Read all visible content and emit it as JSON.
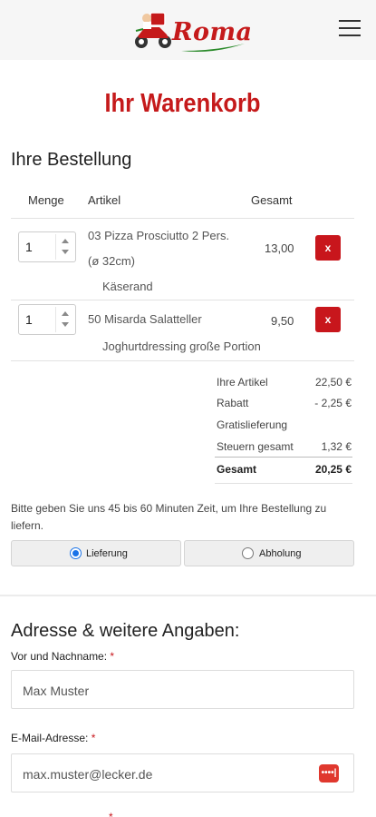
{
  "header": {
    "logo_text": "Roma",
    "menu_icon": "hamburger-menu-icon"
  },
  "page_title": "Ihr Warenkorb",
  "order": {
    "title": "Ihre Bestellung",
    "columns": [
      "Menge",
      "Artikel",
      "Gesamt"
    ],
    "items": [
      {
        "qty": "1",
        "name": "03 Pizza Prosciutto 2 Pers.",
        "size": "(ø 32cm)",
        "extra": "Käserand",
        "total": "13,00",
        "delete_label": "x"
      },
      {
        "qty": "1",
        "name": "50 Misarda Salatteller",
        "size": "",
        "extra": "Joghurtdressing große Portion",
        "total": "9,50",
        "delete_label": "x"
      }
    ]
  },
  "summary": {
    "items_label": "Ihre Artikel",
    "items_value": "22,50 €",
    "discount_label": "Rabatt",
    "discount_value": "- 2,25 €",
    "delivery_label": "Gratislieferung",
    "tax_label": "Steuern gesamt",
    "tax_value": "1,32 €",
    "total_label": "Gesamt",
    "total_value": "20,25 €"
  },
  "delivery_note": "Bitte geben Sie uns 45 bis 60 Minuten Zeit, um Ihre Bestellung zu liefern.",
  "options": {
    "delivery_label": "Lieferung",
    "pickup_label": "Abholung",
    "selected": "Lieferung"
  },
  "address": {
    "title": "Adresse & weitere Angaben:",
    "name_label": "Vor und Nachname:",
    "name_value": "Max Muster",
    "email_label": "E-Mail-Adresse:",
    "email_value": "max.muster@lecker.de",
    "required_marker": "*",
    "password_icon": "••••|"
  },
  "colors": {
    "brand_red": "#c51a1b",
    "delete_red": "#c8161c",
    "radio_blue": "#1a73e8"
  }
}
